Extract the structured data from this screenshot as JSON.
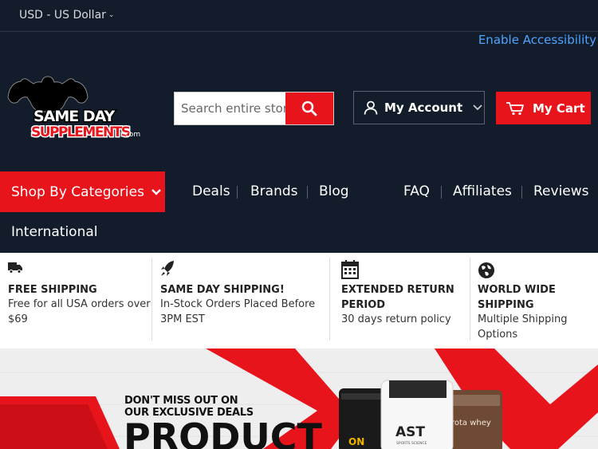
{
  "topbar": {
    "currency": "USD - US Dollar"
  },
  "accessibility": "Enable Accessibility",
  "logo": {
    "line1": "SAME DAY",
    "line2": "SUPPLEMENTS",
    "suffix": ".com"
  },
  "search": {
    "placeholder": "Search entire store here..."
  },
  "account": {
    "label": "My Account"
  },
  "cart": {
    "label": "My Cart"
  },
  "nav": {
    "categories": "Shop By Categories",
    "items": [
      "Deals",
      "Brands",
      "Blog",
      "FAQ",
      "Affiliates",
      "Reviews"
    ],
    "international": "International"
  },
  "features": [
    {
      "icon": "truck-icon",
      "title": "FREE SHIPPING",
      "desc": [
        "Free for all USA orders over",
        "$69"
      ]
    },
    {
      "icon": "rocket-icon",
      "title": "SAME DAY SHIPPING!",
      "desc": [
        "In-Stock Orders Placed Before",
        "3PM EST"
      ]
    },
    {
      "icon": "calendar-icon",
      "title": [
        "EXTENDED RETURN",
        "PERIOD"
      ],
      "desc": [
        "30 days return policy"
      ]
    },
    {
      "icon": "globe-icon",
      "title": [
        "WORLD WIDE",
        "SHIPPING"
      ],
      "desc": [
        "Multiple Shipping",
        "Options"
      ]
    }
  ],
  "banner": {
    "tagline": [
      "DON'T MISS OUT ON",
      "OUR EXCLUSIVE DEALS"
    ],
    "headline": "PRODUCT",
    "products": [
      "ON",
      "AST",
      "rota whey"
    ],
    "ast_subtitle": "SPORTS SCIENCE"
  },
  "colors": {
    "background": "#131c2a",
    "accent": "#e8141c",
    "link": "#4da3ff"
  }
}
